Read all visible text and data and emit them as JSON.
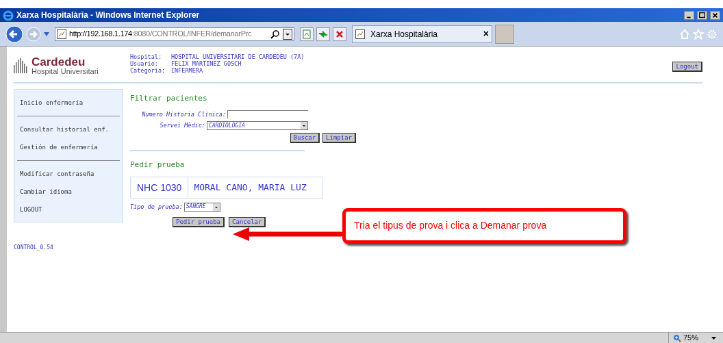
{
  "window": {
    "title": "Xarxa Hospitalària - Windows Internet Explorer"
  },
  "browser": {
    "address_host": "http://192.168.1.174",
    "address_path": ":8080/CONTROL/INFER/demanarPrc",
    "tab": "Xarxa Hospitalària",
    "tab_close": "×",
    "zoom": "75%"
  },
  "logo": {
    "name": "Cardedeu",
    "subtitle": "Hospital Universitari"
  },
  "header": [
    {
      "label": "Hospital:",
      "value": "HOSPITAL UNIVERSITARI DE CARDEDEU (7A)"
    },
    {
      "label": "Usuario:",
      "value": "FELIX MARTINEZ GOSCH"
    },
    {
      "label": "Categoria:",
      "value": "INFERMERA"
    }
  ],
  "logout_button": "Logout",
  "sidebar": {
    "groups": [
      [
        "Inicio enfermería"
      ],
      [
        "Consultar historial enf.",
        "Gestión de enfermería"
      ],
      [
        "Modificar contraseña",
        "Cambiar idioma",
        "LOGOUT"
      ]
    ]
  },
  "filter": {
    "title": "Filtrar pacientes",
    "fields": [
      {
        "kind": "text",
        "label": "Numero Historia Clínica:"
      },
      {
        "kind": "select",
        "label": "Servei Mèdic:",
        "value": "CARDIOLOGIA"
      }
    ],
    "buttons": [
      "Buscar",
      "Limpiar"
    ]
  },
  "request": {
    "title": "Pedir prueba",
    "patient_nhc": "NHC 1030",
    "patient_name": "MORAL CANO, MARIA LUZ",
    "test_type": {
      "label": "Tipo de prueba:",
      "value": "SANGRE"
    },
    "buttons": [
      "Pedir prueba",
      "Cancelar"
    ]
  },
  "version": "CONTROL_0.54",
  "callout": "Tria el tipus de prova i clica a Demanar prova"
}
